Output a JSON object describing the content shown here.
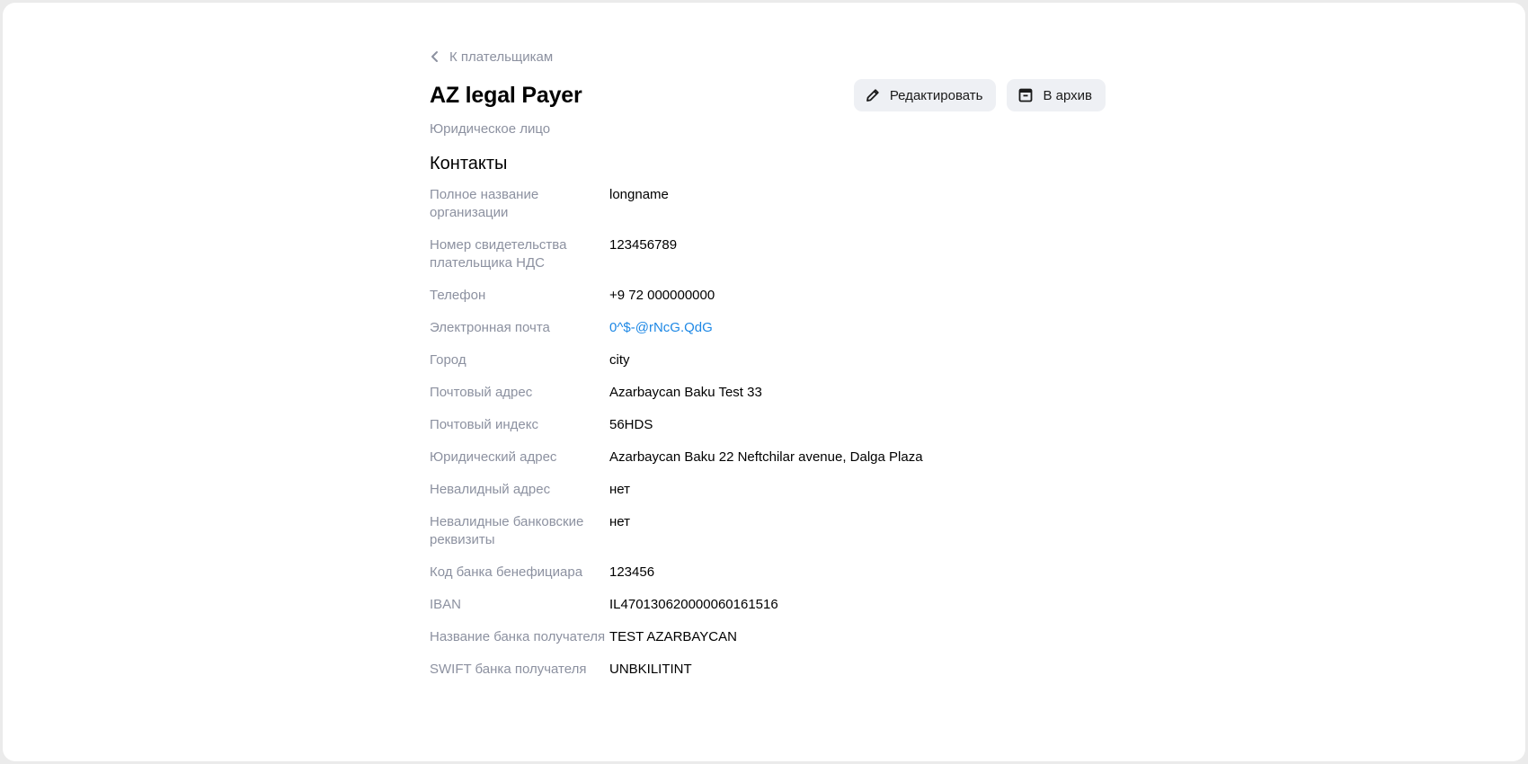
{
  "nav": {
    "back_label": "К плательщикам"
  },
  "header": {
    "title": "AZ legal Payer",
    "subtitle": "Юридическое лицо",
    "edit_label": "Редактировать",
    "archive_label": "В архив"
  },
  "contacts": {
    "title": "Контакты",
    "rows": [
      {
        "label": "Полное название организации",
        "value": "longname"
      },
      {
        "label": "Номер свидетельства плательщика НДС",
        "value": "123456789"
      },
      {
        "label": "Телефон",
        "value": "+9 72 000000000"
      },
      {
        "label": "Электронная почта",
        "value": "0^$-@rNcG.QdG"
      },
      {
        "label": "Город",
        "value": "city"
      },
      {
        "label": "Почтовый адрес",
        "value": "Azarbaycan Baku Test 33"
      },
      {
        "label": "Почтовый индекс",
        "value": "56HDS"
      },
      {
        "label": "Юридический адрес",
        "value": "Azarbaycan Baku 22 Neftchilar avenue, Dalga Plaza"
      },
      {
        "label": "Невалидный адрес",
        "value": "нет"
      },
      {
        "label": "Невалидные банковские реквизиты",
        "value": "нет"
      },
      {
        "label": "Код банка бенефициара",
        "value": "123456"
      },
      {
        "label": "IBAN",
        "value": "IL470130620000060161516"
      },
      {
        "label": "Название банка получателя",
        "value": "TEST AZARBAYCAN"
      },
      {
        "label": "SWIFT банка получателя",
        "value": "UNBKILITINT"
      }
    ]
  },
  "colors": {
    "link": "#1e88e5",
    "muted": "#8c91a0",
    "button_bg": "#eef0f4"
  }
}
